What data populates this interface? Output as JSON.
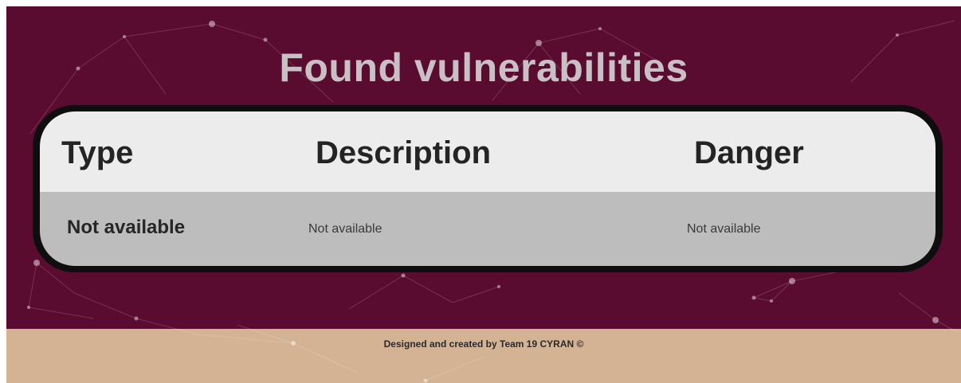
{
  "page": {
    "title": "Found vulnerabilities"
  },
  "table": {
    "headers": [
      "Type",
      "Description",
      "Danger"
    ],
    "rows": [
      [
        "Not available",
        "Not available",
        "Not available"
      ]
    ]
  },
  "footer": {
    "text": "Designed and created by Team 19 CYRAN ©"
  },
  "colors": {
    "hero_background": "#5a0c30",
    "footer_background": "#d4b394",
    "table_header": "#ececec",
    "table_row": "#bdbdbd",
    "table_border": "#0e0e0e",
    "title_text": "#c9c0c5"
  }
}
